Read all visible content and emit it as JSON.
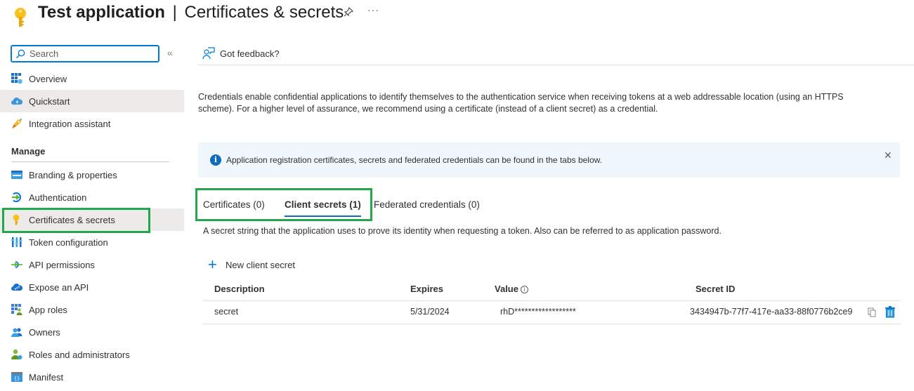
{
  "header": {
    "app_name": "Test application",
    "separator": "|",
    "page_name": "Certificates & secrets",
    "more_label": "···",
    "app_icon": "key-icon",
    "pin_icon": "pin-icon"
  },
  "sidebar": {
    "search_placeholder": "Search",
    "collapse_label": "«",
    "items_top": [
      {
        "label": "Overview",
        "icon": "overview-icon"
      },
      {
        "label": "Quickstart",
        "icon": "quickstart-cloud-icon"
      },
      {
        "label": "Integration assistant",
        "icon": "rocket-icon"
      }
    ],
    "section_title": "Manage",
    "items_manage": [
      {
        "label": "Branding & properties",
        "icon": "branding-icon"
      },
      {
        "label": "Authentication",
        "icon": "authentication-icon"
      },
      {
        "label": "Certificates & secrets",
        "icon": "key-icon",
        "selected": true
      },
      {
        "label": "Token configuration",
        "icon": "token-config-icon"
      },
      {
        "label": "API permissions",
        "icon": "api-permissions-icon"
      },
      {
        "label": "Expose an API",
        "icon": "expose-api-cloud-icon"
      },
      {
        "label": "App roles",
        "icon": "app-roles-icon"
      },
      {
        "label": "Owners",
        "icon": "owners-icon"
      },
      {
        "label": "Roles and administrators",
        "icon": "roles-admin-icon"
      },
      {
        "label": "Manifest",
        "icon": "manifest-icon"
      }
    ]
  },
  "main": {
    "feedback_label": "Got feedback?",
    "intro": "Credentials enable confidential applications to identify themselves to the authentication service when receiving tokens at a web addressable location (using an HTTPS scheme). For a higher level of assurance, we recommend using a certificate (instead of a client secret) as a credential.",
    "info_bar": {
      "text": "Application registration certificates, secrets and federated credentials can be found in the tabs below.",
      "close_label": "✕"
    },
    "tabs": [
      {
        "label": "Certificates (0)",
        "active": false
      },
      {
        "label": "Client secrets (1)",
        "active": true
      },
      {
        "label": "Federated credentials (0)",
        "active": false
      }
    ],
    "tab_description": "A secret string that the application uses to prove its identity when requesting a token. Also can be referred to as application password.",
    "new_secret_label": "New client secret",
    "table": {
      "headers": {
        "description": "Description",
        "expires": "Expires",
        "value": "Value",
        "secret_id": "Secret ID"
      },
      "rows": [
        {
          "description": "secret",
          "expires": "5/31/2024",
          "value": "rhD******************",
          "secret_id": "3434947b-77f7-417e-aa33-88f0776b2ce9"
        }
      ]
    }
  },
  "colors": {
    "accent": "#0078d4",
    "highlight": "#22a74a",
    "info_bg": "#eff6fc",
    "selected_bg": "#edebe9"
  }
}
